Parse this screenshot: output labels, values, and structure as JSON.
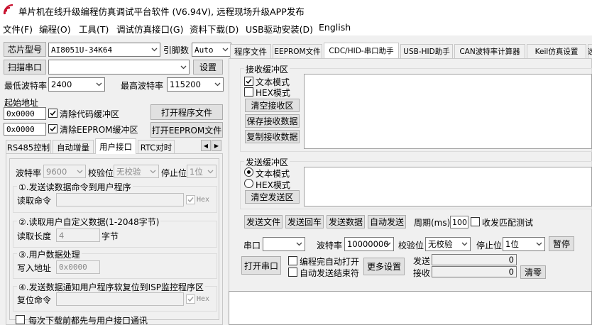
{
  "window": {
    "title": "单片机在线升级编程仿真调试平台软件 (V6.94V), 远程现场升级APP发布"
  },
  "menu": [
    "文件(F)",
    "编程(O)",
    "工具(T)",
    "调试仿真接口(G)",
    "资料下载(D)",
    "USB驱动安装(D)",
    "English"
  ],
  "left": {
    "chip_model_label": "芯片型号",
    "chip_model_value": "AI8051U-34K64",
    "pin_count_label": "引脚数",
    "pin_count_value": "Auto",
    "scan_port_label": "扫描串口",
    "scan_port_value": "",
    "settings_label": "设置",
    "min_baud_label": "最低波特率",
    "min_baud_value": "2400",
    "max_baud_label": "最高波特率",
    "max_baud_value": "115200",
    "start_addr_label": "起始地址",
    "addr1": "0x0000",
    "clear_code_label": "清除代码缓冲区",
    "open_program_label": "打开程序文件",
    "addr2": "0x0000",
    "clear_eeprom_label": "清除EEPROM缓冲区",
    "open_eeprom_label": "打开EEPROM文件",
    "tabs": [
      "RS485控制",
      "自动增量",
      "用户接口",
      "RTC对时"
    ],
    "scroll_left": "◀",
    "scroll_right": "▶",
    "user_if": {
      "baud_label": "波特率",
      "baud_value": "9600",
      "parity_label": "校验位",
      "parity_value": "无校验",
      "stop_label": "停止位",
      "stop_value": "1位",
      "g1_title": "①.发送读数据命令到用户程序",
      "g1_field_label": "读取命令",
      "g1_field_value": "",
      "hex_label": "Hex",
      "g2_title": "②.读取用户自定义数据(1-2048字节)",
      "g2_field_label": "读取长度",
      "g2_field_value": "4",
      "g2_unit": "字节",
      "g3_title": "③.用户数据处理",
      "g3_field_label": "写入地址",
      "g3_field_value": "0x0000",
      "g4_title": "④.发送数据通知用户程序软复位到ISP监控程序区",
      "g4_field_label": "复位命令",
      "g4_field_value": "",
      "hex_label2": "Hex",
      "bottom_check_label": "每次下载前都先与用户接口通讯"
    }
  },
  "right": {
    "tabs": [
      "程序文件",
      "EEPROM文件",
      "CDC/HID-串口助手",
      "USB-HID助手",
      "CAN波特率计算器",
      "Keil仿真设置",
      "选"
    ],
    "recv": {
      "title": "接收缓冲区",
      "text_mode": "文本模式",
      "hex_mode": "HEX模式",
      "clear": "清空接收区",
      "save": "保存接收数据",
      "copy": "复制接收数据"
    },
    "send": {
      "title": "发送缓冲区",
      "text_mode": "文本模式",
      "hex_mode": "HEX模式",
      "clear": "清空发送区"
    },
    "actions": {
      "send_file": "发送文件",
      "send_enter": "发送回车",
      "send_data": "发送数据",
      "auto_send": "自动发送",
      "period_label": "周期(ms)",
      "period_value": "100",
      "recv_match": "收发匹配测试"
    },
    "serial": {
      "port_label": "串口",
      "port_value": "",
      "baud_label": "波特率",
      "baud_value": "10000000",
      "parity_label": "校验位",
      "parity_value": "无校验",
      "stop_label": "停止位",
      "stop_value": "1位",
      "pause": "暂停",
      "open_port": "打开串口",
      "auto_open": "编程完自动打开",
      "auto_end": "自动发送结束符",
      "more": "更多设置",
      "send_label": "发送",
      "send_count": "0",
      "recv_label": "接收",
      "recv_count": "0",
      "clear": "清零"
    }
  },
  "colors": {
    "logo": "#c8102e",
    "accent": "#0078d7"
  }
}
